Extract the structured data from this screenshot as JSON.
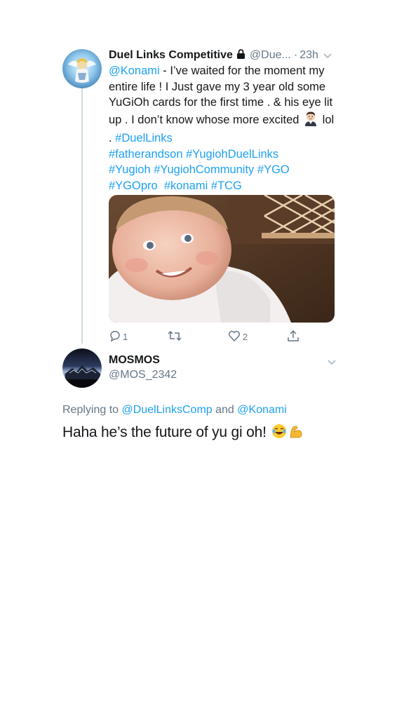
{
  "tweet": {
    "author_name": "Duel Links Competitive",
    "handle": "@Due...",
    "separator": "·",
    "time": "23h",
    "text_parts": {
      "mention": "@Konami",
      "body1": " - I’ve waited for the moment my entire life ! I Just gave my 3 year old some YuGiOh cards for the first time . & his eye lit up . I don’t know whose more excited ",
      "body2": " lol . ",
      "hashtags_line1": "#DuelLinks",
      "hashtags_line2": "#fatherandson #YugiohDuelLinks",
      "hashtags_line3": "#Yugioh #YugiohCommunity #YGO",
      "hashtags_line4": "#YGOpro  #konami #TCG"
    },
    "reply_count": "1",
    "retweet_count": "",
    "like_count": "2"
  },
  "reply": {
    "author_name": "MOSMOS",
    "handle": "@MOS_2342",
    "replying_prefix": "Replying to ",
    "replying_to_1": "@DuelLinksComp",
    "replying_and": " and ",
    "replying_to_2": "@Konami",
    "text": "Haha he’s the future of yu gi oh! "
  },
  "colors": {
    "link": "#1da1f2",
    "secondary_text": "#657786",
    "primary_text": "#14171a",
    "thread_line": "#cfd9de"
  },
  "icons": [
    "lock-icon",
    "chevron-down-icon",
    "reply-icon",
    "retweet-icon",
    "like-icon",
    "share-icon",
    "joy-emoji",
    "flexed-biceps-emoji",
    "man-face-emoji"
  ]
}
